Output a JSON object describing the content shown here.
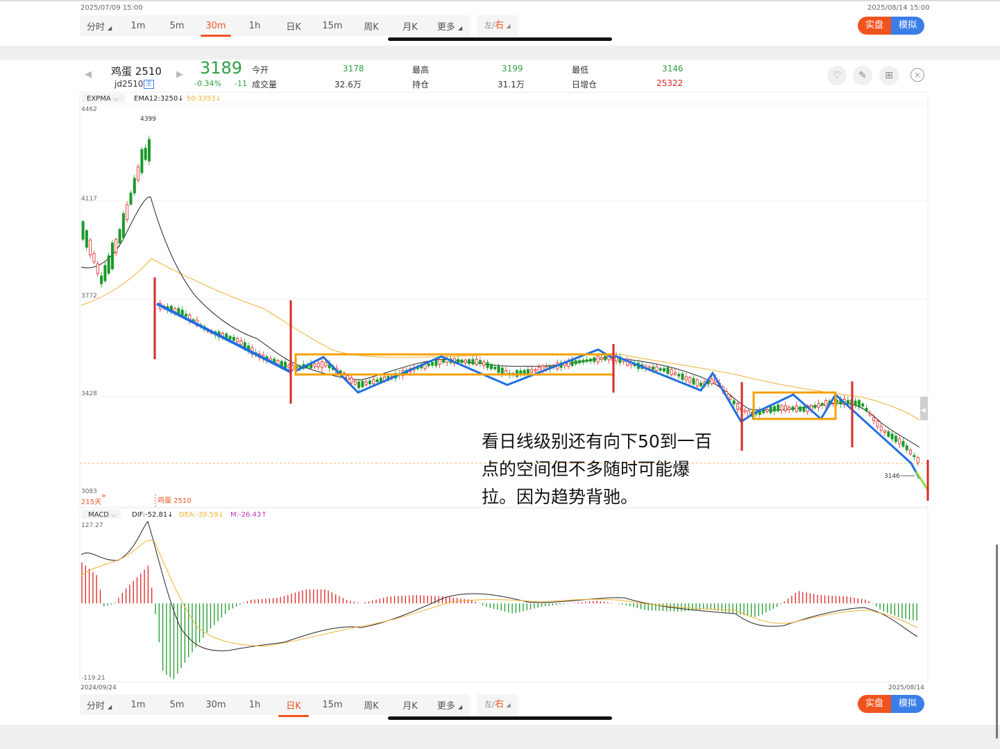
{
  "top_panel": {
    "start_date": "2025/07/09 15:00",
    "end_date": "2025/08/14 15:00",
    "tabs": [
      "分时",
      "1m",
      "5m",
      "30m",
      "1h",
      "日K",
      "15m",
      "周K",
      "月K",
      "更多"
    ],
    "active_tab": "30m",
    "lr_left": "左",
    "lr_right": "右",
    "mode_real": "实盘",
    "mode_sim": "模拟"
  },
  "header": {
    "name": "鸡蛋 2510",
    "code": "jd2510",
    "code_badge": "主",
    "price": "3189",
    "change_pct": "-0.34%",
    "change_abs": "-11",
    "stats": [
      {
        "label": "今开",
        "value": "3178",
        "color": "#2ea043"
      },
      {
        "label": "最高",
        "value": "3199",
        "color": "#2ea043"
      },
      {
        "label": "最低",
        "value": "3146",
        "color": "#2ea043"
      },
      {
        "label": "成交量",
        "value": "32.6万",
        "color": "#333333"
      },
      {
        "label": "持仓",
        "value": "31.1万",
        "color": "#333333"
      },
      {
        "label": "日增仓",
        "value": "25322",
        "color": "#e02020"
      }
    ]
  },
  "indicator_bar": {
    "name": "EXPMA",
    "ema12": "EMA12:3250↓",
    "ema50": "50:3353↓"
  },
  "price_axis": {
    "labels": [
      "4462",
      "4117",
      "3772",
      "3428",
      "3083"
    ],
    "high_marker": "4399",
    "low_marker": "3146",
    "days_badge": "215天",
    "contract_marker": "鸡蛋 2510"
  },
  "annotation": {
    "lines": [
      "看日线级别还有向下50到一百",
      "点的空间但不多随时可能爆",
      "拉。因为趋势背驰。"
    ]
  },
  "macd_bar": {
    "name": "MACD",
    "dif": "DIF:-52.81↓",
    "dea": "DEA:-39.59↓",
    "m": "M:-26.43↑"
  },
  "macd_axis": {
    "top": "127.27",
    "bottom": "-119.21"
  },
  "date_axis": {
    "start": "2024/09/24",
    "end": "2025/08/14"
  },
  "bottom_panel": {
    "tabs": [
      "分时",
      "1m",
      "5m",
      "30m",
      "1h",
      "日K",
      "15m",
      "周K",
      "月K",
      "更多"
    ],
    "active_tab": "日K",
    "lr_left": "左",
    "lr_right": "右",
    "mode_real": "实盘",
    "mode_sim": "模拟"
  },
  "colors": {
    "up": "#e02020",
    "down": "#1a9a2a",
    "accent": "#f0541e",
    "blue_button": "#3b7ee8",
    "ema12_line": "#222222",
    "ema50_line": "#f0b030",
    "trend_line": "#1f6fe0",
    "box": "#f5a000",
    "marker": "#d62a2a"
  },
  "chart_data": {
    "type": "candlestick",
    "ylim": [
      3083,
      4462
    ],
    "x_start": "2024/09/24",
    "x_end": "2025/08/14",
    "high": 4399,
    "low": 3146,
    "last": 3189,
    "macd_ylim": [
      -119.21,
      127.27
    ]
  }
}
